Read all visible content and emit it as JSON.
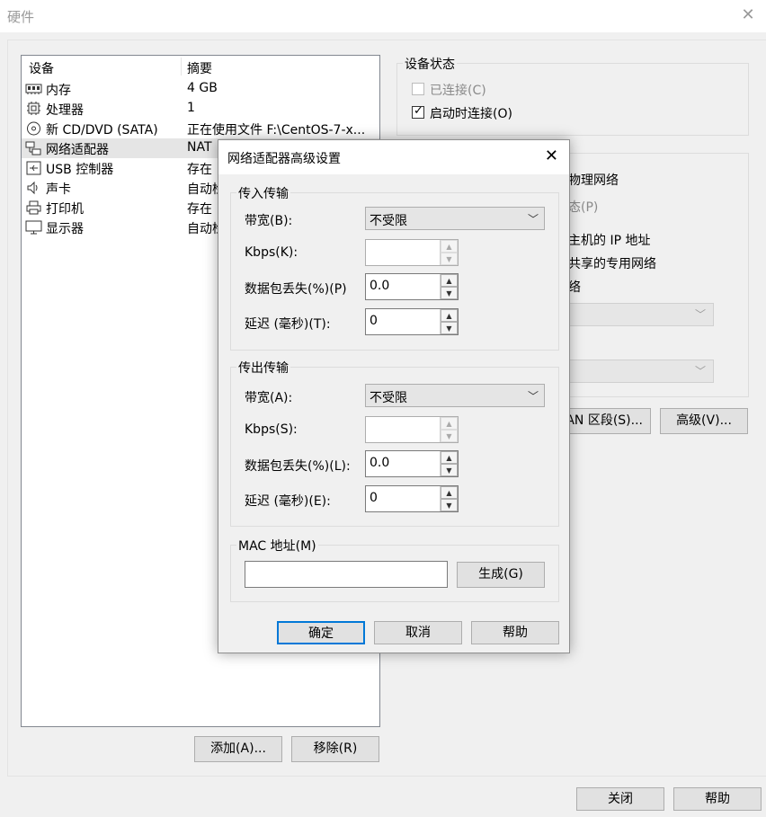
{
  "window": {
    "title": "硬件",
    "close_glyph": "✕"
  },
  "device_list": {
    "columns": [
      "设备",
      "摘要"
    ],
    "rows": [
      {
        "name": "内存",
        "summary": "4 GB",
        "icon": "memory-icon"
      },
      {
        "name": "处理器",
        "summary": "1",
        "icon": "processor-icon"
      },
      {
        "name": "新 CD/DVD (SATA)",
        "summary": "正在使用文件 F:\\CentOS-7-x...",
        "icon": "cd-dvd-icon"
      },
      {
        "name": "网络适配器",
        "summary": "NAT",
        "icon": "network-adapter-icon",
        "selected": true
      },
      {
        "name": "USB 控制器",
        "summary": "存在",
        "icon": "usb-icon"
      },
      {
        "name": "声卡",
        "summary": "自动检",
        "icon": "speaker-icon"
      },
      {
        "name": "打印机",
        "summary": "存在",
        "icon": "printer-icon"
      },
      {
        "name": "显示器",
        "summary": "自动检",
        "icon": "monitor-icon"
      }
    ],
    "add_label": "添加(A)...",
    "remove_label": "移除(R)"
  },
  "device_status": {
    "title": "设备状态",
    "connected_label": "已连接(C)",
    "connected_checked": false,
    "connect_on_start_label": "启动时连接(O)",
    "connect_on_start_checked": true
  },
  "net_connection": {
    "frag_physical": "物理网络",
    "frag_state": "态(P)",
    "frag_host_ip": "主机的 IP 地址",
    "frag_private": "共享的专用网络",
    "frag_net": "络",
    "lan_segment_label": "AN 区段(S)...",
    "advanced_label": "高级(V)..."
  },
  "dialog": {
    "title": "网络适配器高级设置",
    "close_glyph": "✕",
    "incoming": {
      "title": "传入传输",
      "bandwidth_label": "带宽(B):",
      "bandwidth_value": "不受限",
      "kbps_label": "Kbps(K):",
      "kbps_value": "",
      "loss_label": "数据包丢失(%)(P)",
      "loss_value": "0.0",
      "latency_label": "延迟 (毫秒)(T):",
      "latency_value": "0"
    },
    "outgoing": {
      "title": "传出传输",
      "bandwidth_label": "带宽(A):",
      "bandwidth_value": "不受限",
      "kbps_label": "Kbps(S):",
      "kbps_value": "",
      "loss_label": "数据包丢失(%)(L):",
      "loss_value": "0.0",
      "latency_label": "延迟 (毫秒)(E):",
      "latency_value": "0"
    },
    "mac": {
      "title": "MAC 地址(M)",
      "value": "",
      "generate_label": "生成(G)"
    },
    "ok_label": "确定",
    "cancel_label": "取消",
    "help_label": "帮助"
  },
  "footer": {
    "close_label": "关闭",
    "help_label": "帮助"
  },
  "colors": {
    "accent": "#0078d7",
    "selection": "#e5e5e5",
    "button_face": "#e1e1e1"
  }
}
